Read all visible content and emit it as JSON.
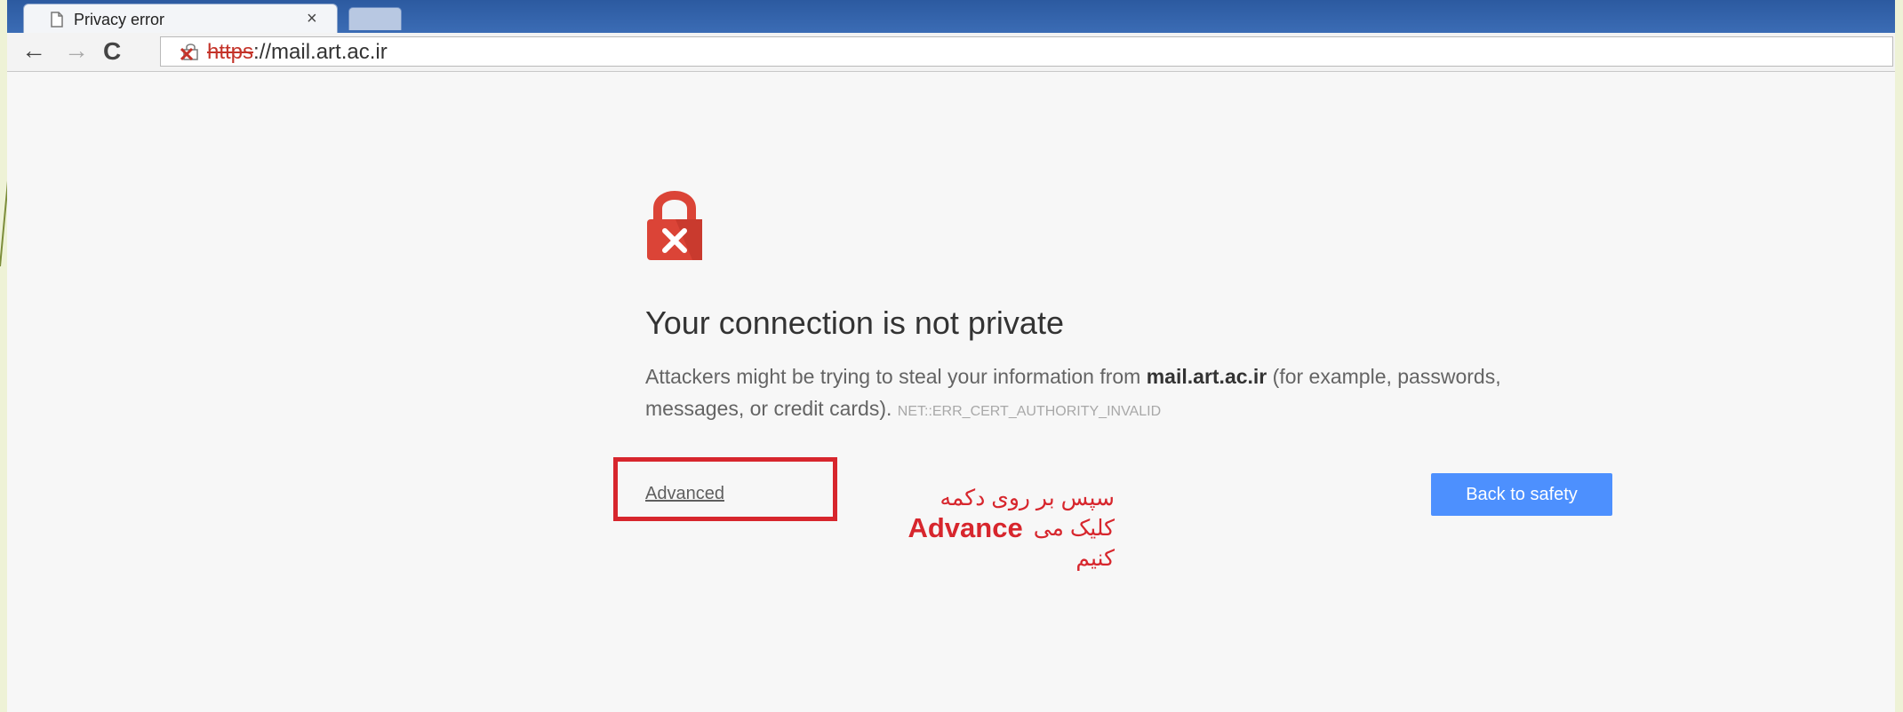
{
  "browser": {
    "tab_title": "Privacy error",
    "tab_close": "×",
    "back_icon": "←",
    "forward_icon": "→",
    "reload_icon": "C",
    "url_scheme": "https",
    "url_rest": "://mail.art.ac.ir"
  },
  "page": {
    "title": "Your connection is not private",
    "description_prefix": "Attackers might be trying to steal your information from ",
    "domain": "mail.art.ac.ir",
    "description_suffix": " (for example, passwords, messages, or credit cards). ",
    "error_code": "NET::ERR_CERT_AUTHORITY_INVALID",
    "advanced_label": "Advanced",
    "back_to_safety_label": "Back to safety"
  },
  "annotation": {
    "line_1": "سپس بر روی دکمه",
    "line_2_word": "کلیک می",
    "line_2_english": "Advance",
    "line_3": "کنیم"
  },
  "colors": {
    "accent_blue": "#4d90fe",
    "error_red": "#db4437",
    "annotation_red": "#d7262d",
    "browser_frame_blue": "#2c5aa0"
  },
  "icons": {
    "page": "page-icon",
    "back": "back-arrow-icon",
    "forward": "forward-arrow-icon",
    "reload": "reload-icon",
    "certificate_error": "broken-lock-icon",
    "privacy_error": "red-padlock-x-icon"
  }
}
